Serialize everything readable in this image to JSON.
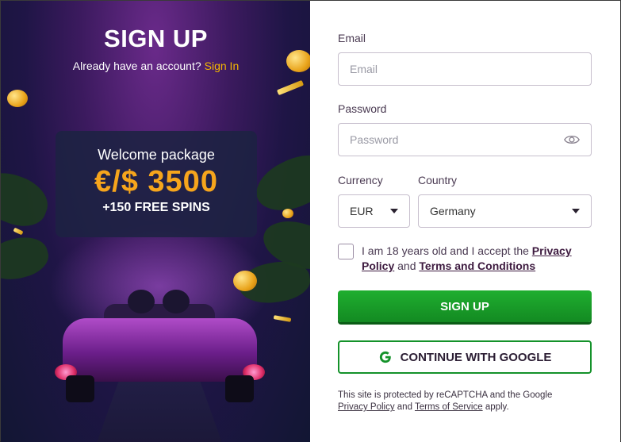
{
  "promo": {
    "title": "SIGN UP",
    "have_account": "Already have an account?",
    "sign_in_link": "Sign In",
    "welcome_line": "Welcome package",
    "amount": "€/$ 3500",
    "spins": "+150 FREE SPINS"
  },
  "form": {
    "email_label": "Email",
    "email_placeholder": "Email",
    "password_label": "Password",
    "password_placeholder": "Password",
    "currency_label": "Currency",
    "currency_value": "EUR",
    "country_label": "Country",
    "country_value": "Germany",
    "terms_pre": "I am 18 years old and I accept the",
    "terms_privacy": "Privacy Policy",
    "terms_and": "and",
    "terms_conditions": "Terms and Conditions",
    "signup_button": "SIGN UP",
    "google_button": "CONTINUE WITH GOOGLE",
    "captcha_pre": "This site is protected by reCAPTCHA and the Google",
    "captcha_privacy": "Privacy Policy",
    "captcha_and": "and",
    "captcha_terms": "Terms of Service",
    "captcha_post": "apply."
  },
  "colors": {
    "accent_gold": "#f5b800",
    "amount_orange": "#f6a51c",
    "signup_green": "#1fae2f"
  },
  "icons": [
    "eye-icon",
    "google-icon",
    "chevron-down-icon"
  ]
}
